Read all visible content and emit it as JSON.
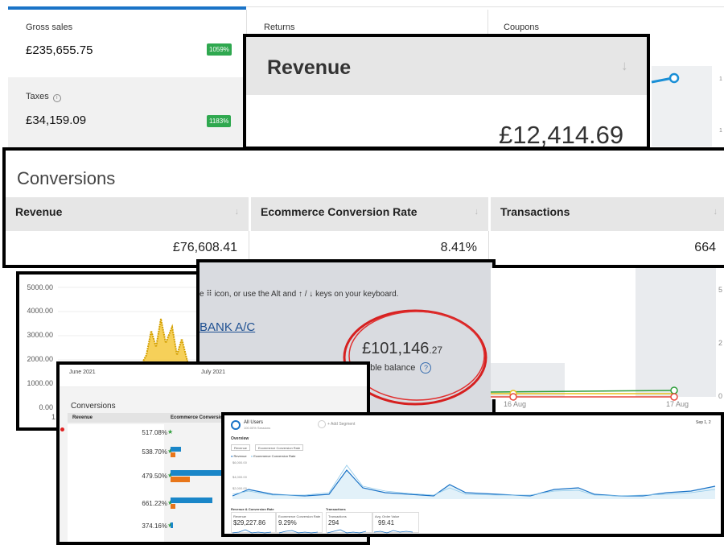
{
  "stats": {
    "gross_sales": {
      "label": "Gross sales",
      "value": "£235,655.75",
      "badge": "1059%"
    },
    "taxes": {
      "label": "Taxes",
      "value": "£34,159.09",
      "badge": "1183%"
    },
    "returns_label": "Returns",
    "coupons_label": "Coupons",
    "info_icon": "info-icon"
  },
  "revenue_card": {
    "title": "Revenue",
    "value": "£12,414.69"
  },
  "conversions": {
    "title": "Conversions",
    "columns": [
      {
        "label": "Revenue",
        "value": "£76,608.41"
      },
      {
        "label": "Ecommerce Conversion Rate",
        "value": "8.41%"
      },
      {
        "label": "Transactions",
        "value": "664"
      }
    ]
  },
  "chart4": {
    "y_ticks": [
      "5000.00",
      "4000.00",
      "3000.00",
      "2000.00",
      "1000.00",
      "0.00"
    ],
    "x_label": "1"
  },
  "bank": {
    "instruction": "e ⠿ icon, or use the Alt and ↑ / ↓ keys on your keyboard.",
    "account_link": "BANK A/C",
    "amount_main": "£101,146",
    "amount_pence": ".27",
    "balance_label": "able balance"
  },
  "chart6": {
    "x_labels": [
      "16 Aug",
      "17 Aug"
    ],
    "right_ticks": [
      "5",
      "2",
      "0"
    ],
    "series_colors": [
      "#2e9e3a",
      "#e8c21a",
      "#e8473c"
    ]
  },
  "conv7": {
    "months": [
      "June 2021",
      "July 2021"
    ],
    "title": "Conversions",
    "col_revenue": "Revenue",
    "col_rate": "Ecommerce Conversion",
    "rows": [
      "517.08%",
      "538.70%",
      "479.50%",
      "661.22%",
      "374.16%"
    ]
  },
  "ga": {
    "segment": "All Users",
    "segment_sub": "100.00% Sessions",
    "add_segment": "+ Add Segment",
    "date": "Sep 1, 2",
    "overview": "Overview",
    "metric_1": "Revenue",
    "metric_2": "Ecommerce Conversion Rate",
    "legend_1": "Revenue",
    "legend_2": "Ecommerce Conversion Rate",
    "y_ticks": [
      "$6,000.00",
      "$4,000.00",
      "$2,000.00"
    ],
    "section_1": "Revenue & Conversion Rate",
    "section_2": "Transactions",
    "kpis": [
      {
        "label": "Revenue",
        "value": "$29,227.86"
      },
      {
        "label": "Ecommerce Conversion Rate",
        "value": "9.29%"
      },
      {
        "label": "Transactions",
        "value": "294"
      },
      {
        "label": "Avg. Order Value",
        "value": "99.41"
      }
    ]
  }
}
